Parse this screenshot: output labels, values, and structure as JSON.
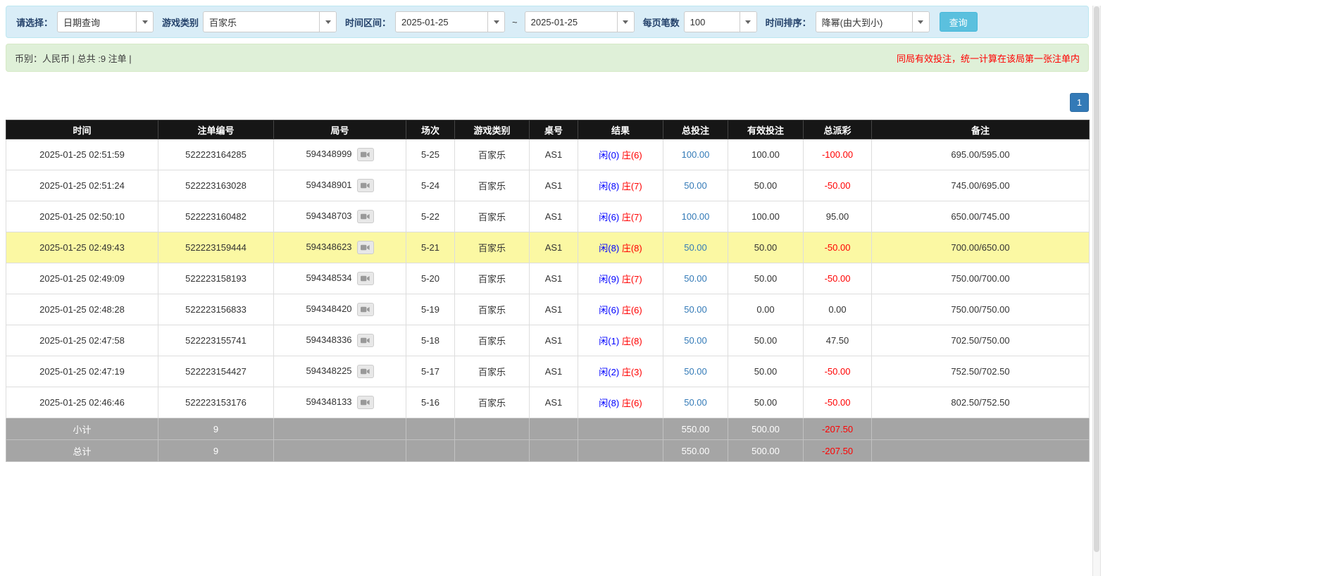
{
  "filters": {
    "select_label": "请选择：",
    "select_value": "日期查询",
    "game_type_label": "游戏类别",
    "game_type_value": "百家乐",
    "date_range_label": "时间区间：",
    "date_from": "2025-01-25",
    "tilde": "~",
    "date_to": "2025-01-25",
    "page_size_label": "每页笔数",
    "page_size_value": "100",
    "sort_label": "时间排序：",
    "sort_value": "降幂(由大到小)",
    "search_button": "查询"
  },
  "summary": {
    "left": "币别：人民币 | 总共 :9 注单 |",
    "right": "同局有效投注，统一计算在该局第一张注单内"
  },
  "pagination": {
    "page": "1"
  },
  "colors": {
    "player_blue": "#0000ff",
    "banker_red": "#ff0000",
    "link_blue": "#337ab7",
    "highlight_yellow": "#fbf8a3",
    "header_black": "#161616",
    "footer_gray": "#a5a5a5",
    "query_button_cyan": "#5bc0de",
    "page_button_blue": "#337ab7"
  },
  "table": {
    "headers": [
      "时间",
      "注单编号",
      "局号",
      "场次",
      "游戏类别",
      "桌号",
      "结果",
      "总投注",
      "有效投注",
      "总派彩",
      "备注"
    ],
    "rows": [
      {
        "time": "2025-01-25 02:51:59",
        "bet_id": "522223164285",
        "round": "594348999",
        "session": "5-25",
        "game": "百家乐",
        "table_no": "AS1",
        "player": "闲(0)",
        "banker": "庄(6)",
        "total_bet": "100.00",
        "valid_bet": "100.00",
        "payout": "-100.00",
        "note": "695.00/595.00",
        "highlighted": false
      },
      {
        "time": "2025-01-25 02:51:24",
        "bet_id": "522223163028",
        "round": "594348901",
        "session": "5-24",
        "game": "百家乐",
        "table_no": "AS1",
        "player": "闲(8)",
        "banker": "庄(7)",
        "total_bet": "50.00",
        "valid_bet": "50.00",
        "payout": "-50.00",
        "note": "745.00/695.00",
        "highlighted": false
      },
      {
        "time": "2025-01-25 02:50:10",
        "bet_id": "522223160482",
        "round": "594348703",
        "session": "5-22",
        "game": "百家乐",
        "table_no": "AS1",
        "player": "闲(6)",
        "banker": "庄(7)",
        "total_bet": "100.00",
        "valid_bet": "100.00",
        "payout": "95.00",
        "note": "650.00/745.00",
        "highlighted": false
      },
      {
        "time": "2025-01-25 02:49:43",
        "bet_id": "522223159444",
        "round": "594348623",
        "session": "5-21",
        "game": "百家乐",
        "table_no": "AS1",
        "player": "闲(8)",
        "banker": "庄(8)",
        "total_bet": "50.00",
        "valid_bet": "50.00",
        "payout": "-50.00",
        "note": "700.00/650.00",
        "highlighted": true
      },
      {
        "time": "2025-01-25 02:49:09",
        "bet_id": "522223158193",
        "round": "594348534",
        "session": "5-20",
        "game": "百家乐",
        "table_no": "AS1",
        "player": "闲(9)",
        "banker": "庄(7)",
        "total_bet": "50.00",
        "valid_bet": "50.00",
        "payout": "-50.00",
        "note": "750.00/700.00",
        "highlighted": false
      },
      {
        "time": "2025-01-25 02:48:28",
        "bet_id": "522223156833",
        "round": "594348420",
        "session": "5-19",
        "game": "百家乐",
        "table_no": "AS1",
        "player": "闲(6)",
        "banker": "庄(6)",
        "total_bet": "50.00",
        "valid_bet": "0.00",
        "payout": "0.00",
        "note": "750.00/750.00",
        "highlighted": false
      },
      {
        "time": "2025-01-25 02:47:58",
        "bet_id": "522223155741",
        "round": "594348336",
        "session": "5-18",
        "game": "百家乐",
        "table_no": "AS1",
        "player": "闲(1)",
        "banker": "庄(8)",
        "total_bet": "50.00",
        "valid_bet": "50.00",
        "payout": "47.50",
        "note": "702.50/750.00",
        "highlighted": false
      },
      {
        "time": "2025-01-25 02:47:19",
        "bet_id": "522223154427",
        "round": "594348225",
        "session": "5-17",
        "game": "百家乐",
        "table_no": "AS1",
        "player": "闲(2)",
        "banker": "庄(3)",
        "total_bet": "50.00",
        "valid_bet": "50.00",
        "payout": "-50.00",
        "note": "752.50/702.50",
        "highlighted": false
      },
      {
        "time": "2025-01-25 02:46:46",
        "bet_id": "522223153176",
        "round": "594348133",
        "session": "5-16",
        "game": "百家乐",
        "table_no": "AS1",
        "player": "闲(8)",
        "banker": "庄(6)",
        "total_bet": "50.00",
        "valid_bet": "50.00",
        "payout": "-50.00",
        "note": "802.50/752.50",
        "highlighted": false
      }
    ],
    "subtotal": {
      "label": "小计",
      "count": "9",
      "total_bet": "550.00",
      "valid_bet": "500.00",
      "payout": "-207.50"
    },
    "total": {
      "label": "总计",
      "count": "9",
      "total_bet": "550.00",
      "valid_bet": "500.00",
      "payout": "-207.50"
    }
  }
}
